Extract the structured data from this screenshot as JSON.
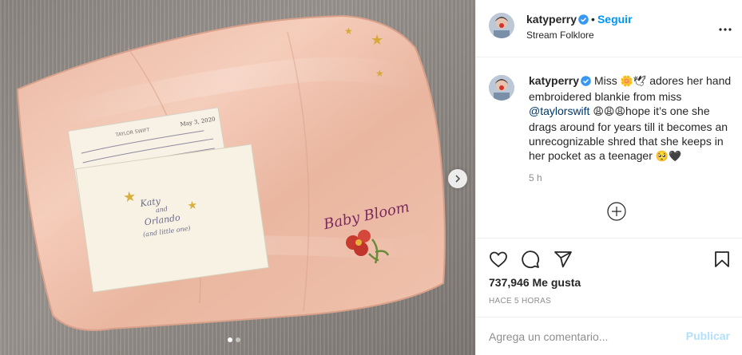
{
  "post": {
    "username": "katyperry",
    "follow_label": "Seguir",
    "separator": "•",
    "subtitle": "Stream Folklore",
    "icons": {
      "verified": "verified-badge-icon",
      "more": "more-options-icon",
      "carousel_next": "chevron-right-icon",
      "load_more": "plus-circle-icon",
      "like": "heart-icon",
      "comment": "comment-icon",
      "share": "share-icon",
      "save": "bookmark-icon"
    },
    "colors": {
      "accent": "#0095f6",
      "mention": "#00376b",
      "publish_disabled": "#b2dffc",
      "verified": "#3897f0"
    }
  },
  "caption": {
    "username": "katyperry",
    "text_1": "Miss",
    "emoji_1": "🌼🕊",
    "text_2": "adores her hand embroidered blankie from miss",
    "mention": "@taylorswift",
    "emoji_2": "😩😩😩",
    "text_3": "hope it’s one she drags around for years till it becomes an unrecognizable shred that she keeps in her pocket as a teenager",
    "emoji_3": "🥺🖤",
    "time": "5 h"
  },
  "stats": {
    "likes": "737,946 Me gusta",
    "ago": "HACE 5 HORAS"
  },
  "comment": {
    "placeholder": "Agrega un comentario...",
    "publish_label": "Publicar"
  },
  "image": {
    "embroidery": "Baby Bloom",
    "note_header": "TAYLOR SWIFT",
    "note_date": "May 3, 2020",
    "card_text": [
      "Katy",
      "and",
      "Orlando",
      "(and little one)"
    ],
    "slide_count": 2,
    "active_slide": 1
  }
}
